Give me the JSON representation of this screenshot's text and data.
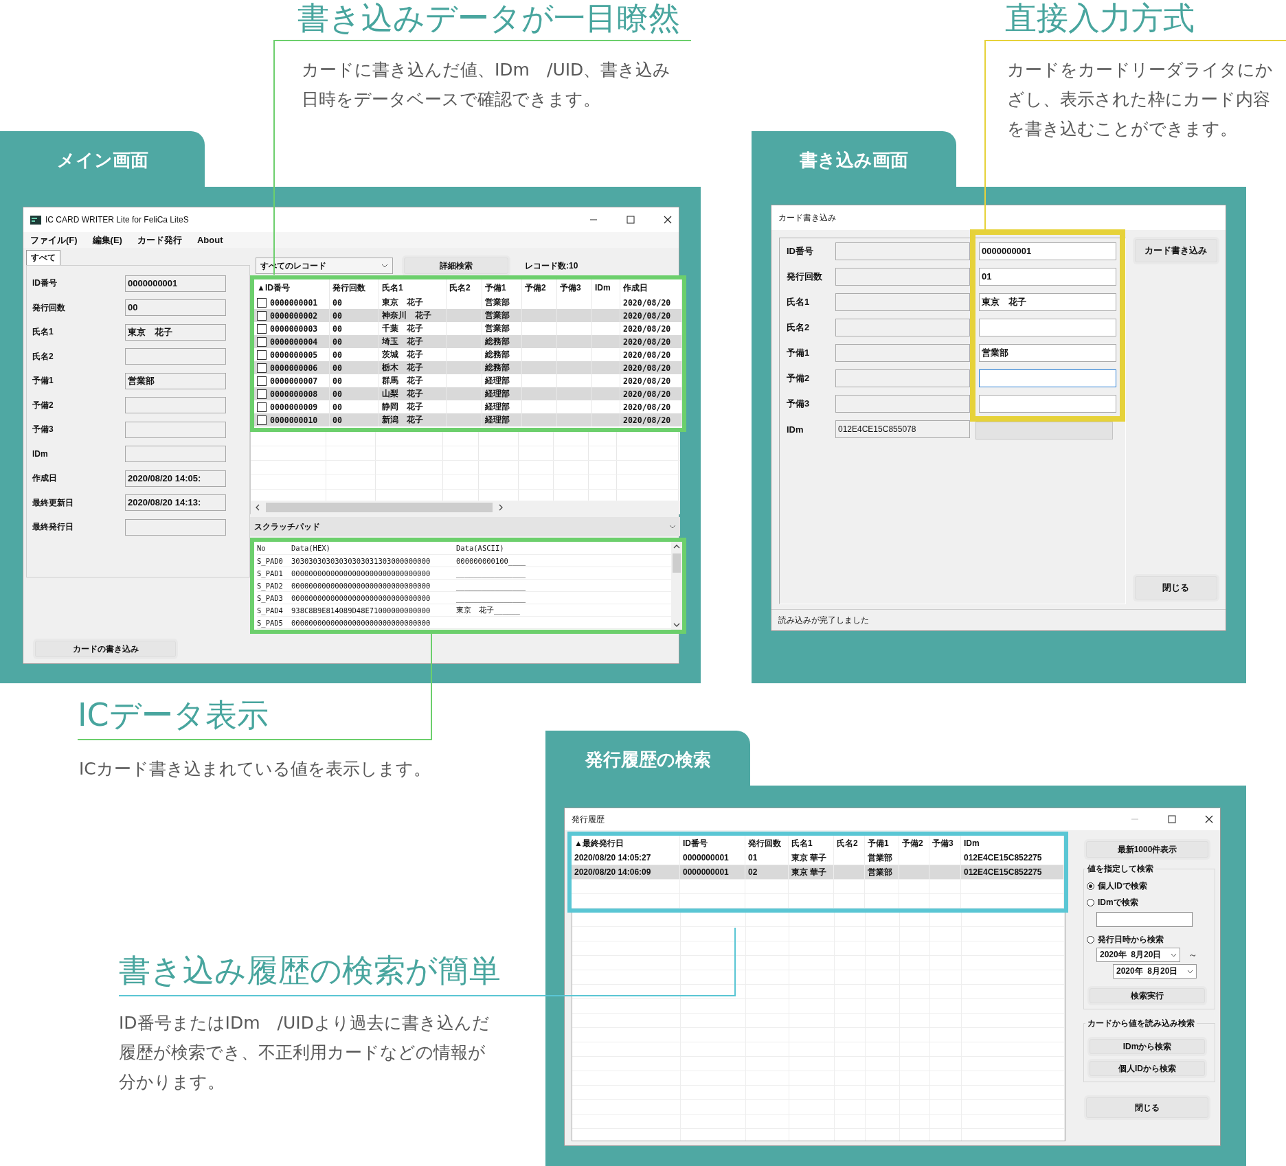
{
  "callouts": [
    {
      "title": "書き込みデータが一目瞭然",
      "lines": [
        "カードに書き込んだ値、IDm　/UID、書き込み",
        "日時をデータベースで確認できます。"
      ],
      "color": "#6ccf6c"
    },
    {
      "title": "直接入力方式",
      "lines": [
        "カードをカードリーダライタにか",
        "ざし、表示された枠にカード内容",
        "を書き込むことができます。"
      ],
      "color": "#e6d23a"
    },
    {
      "title": "ICデータ表示",
      "lines": [
        "ICカード書き込まれている値を表示します。"
      ],
      "color": "#6ccf6c"
    },
    {
      "title": "書き込み履歴の検索が簡単",
      "lines": [
        "ID番号またはIDm　/UIDより過去に書き込んだ",
        "履歴が検索でき、不正利用カードなどの情報が",
        "分かります。"
      ],
      "color": "#5ac6d4"
    }
  ],
  "panels": [
    "メイン画面",
    "書き込み画面",
    "発行履歴の検索"
  ],
  "main_window": {
    "title": "IC CARD WRITER Lite for FeliCa LiteS",
    "menu": [
      "ファイル(F)",
      "編集(E)",
      "カード発行",
      "About"
    ],
    "tabs": [
      {
        "label": "すべて",
        "selected": true
      }
    ],
    "fields": [
      {
        "label": "ID番号",
        "value": "0000000001"
      },
      {
        "label": "発行回数",
        "value": "00"
      },
      {
        "label": "氏名1",
        "value": "東京　花子"
      },
      {
        "label": "氏名2"
      },
      {
        "label": "予備1",
        "value": "営業部"
      },
      {
        "label": "予備2"
      },
      {
        "label": "予備3"
      },
      {
        "label": "IDm"
      },
      {
        "label": "作成日",
        "value": "2020/08/20 14:05:"
      },
      {
        "label": "最終更新日",
        "value": "2020/08/20 14:13:"
      },
      {
        "label": "最終発行日"
      }
    ],
    "write_button": "カードの書き込み",
    "record_filter": "すべてのレコード",
    "search_button": "詳細検索",
    "record_count": "レコード数:10",
    "columns": [
      "▲ID番号",
      "発行回数",
      "氏名1",
      "氏名2",
      "予備1",
      "予備2",
      "予備3",
      "IDm",
      "作成日"
    ],
    "rows": [
      {
        "checked": false,
        "id_number": "0000000001",
        "issue_count": "00",
        "name1": "東京　花子",
        "reserve1": "営業部",
        "created": "2020/08/20"
      },
      {
        "checked": false,
        "id_number": "0000000002",
        "issue_count": "00",
        "name1": "神奈川　花子",
        "reserve1": "営業部",
        "created": "2020/08/20"
      },
      {
        "checked": false,
        "id_number": "0000000003",
        "issue_count": "00",
        "name1": "千葉　花子",
        "reserve1": "営業部",
        "created": "2020/08/20"
      },
      {
        "checked": false,
        "id_number": "0000000004",
        "issue_count": "00",
        "name1": "埼玉　花子",
        "reserve1": "総務部",
        "created": "2020/08/20"
      },
      {
        "checked": false,
        "id_number": "0000000005",
        "issue_count": "00",
        "name1": "茨城　花子",
        "reserve1": "総務部",
        "created": "2020/08/20"
      },
      {
        "checked": false,
        "id_number": "0000000006",
        "issue_count": "00",
        "name1": "栃木　花子",
        "reserve1": "総務部",
        "created": "2020/08/20"
      },
      {
        "checked": false,
        "id_number": "0000000007",
        "issue_count": "00",
        "name1": "群馬　花子",
        "reserve1": "経理部",
        "created": "2020/08/20"
      },
      {
        "checked": false,
        "id_number": "0000000008",
        "issue_count": "00",
        "name1": "山梨　花子",
        "reserve1": "経理部",
        "created": "2020/08/20"
      },
      {
        "checked": false,
        "id_number": "0000000009",
        "issue_count": "00",
        "name1": "静岡　花子",
        "reserve1": "経理部",
        "created": "2020/08/20"
      },
      {
        "checked": false,
        "id_number": "0000000010",
        "issue_count": "00",
        "name1": "新潟　花子",
        "reserve1": "経理部",
        "created": "2020/08/20"
      }
    ],
    "scratchpad": {
      "title": "スクラッチパッド",
      "columns": [
        "No",
        "Data(HEX)",
        "Data(ASCII)"
      ],
      "rows": [
        {
          "no": "S_PAD0",
          "hex": "30303030303030303031303000000000",
          "ascii": "000000000100____"
        },
        {
          "no": "S_PAD1",
          "hex": "00000000000000000000000000000000",
          "ascii": "________________"
        },
        {
          "no": "S_PAD2",
          "hex": "00000000000000000000000000000000",
          "ascii": "________________"
        },
        {
          "no": "S_PAD3",
          "hex": "00000000000000000000000000000000",
          "ascii": "________________"
        },
        {
          "no": "S_PAD4",
          "hex": "938C8B9E814089D48E71000000000000",
          "ascii": "東京　花子______"
        },
        {
          "no": "S_PAD5",
          "hex": "00000000000000000000000000000000"
        }
      ]
    }
  },
  "write_window": {
    "title": "カード書き込み",
    "fields": [
      {
        "label": "ID番号",
        "input": "0000000001",
        "focused": false,
        "disabled": false
      },
      {
        "label": "発行回数",
        "input": "01",
        "focused": false,
        "disabled": false
      },
      {
        "label": "氏名1",
        "input": "東京　花子",
        "focused": false,
        "disabled": false
      },
      {
        "label": "氏名2",
        "focused": false,
        "disabled": false
      },
      {
        "label": "予備1",
        "input": "営業部",
        "focused": false,
        "disabled": false
      },
      {
        "label": "予備2",
        "focused": true,
        "disabled": false
      },
      {
        "label": "予備3",
        "focused": false,
        "disabled": false
      },
      {
        "label": "IDm",
        "current": "012E4CE15C855078",
        "focused": false,
        "disabled": true
      }
    ],
    "write_button": "カード書き込み",
    "close_button": "閉じる",
    "status": "読み込みが完了しました"
  },
  "history_window": {
    "title": "発行履歴",
    "columns": [
      "▲最終発行日",
      "ID番号",
      "発行回数",
      "氏名1",
      "氏名2",
      "予備1",
      "予備2",
      "予備3",
      "IDm"
    ],
    "rows": [
      {
        "last_issued": "2020/08/20 14:05:27",
        "id_number": "0000000001",
        "issue_count": "01",
        "name1": "東京 華子",
        "reserve1": "営業部",
        "idm": "012E4CE15C852275"
      },
      {
        "last_issued": "2020/08/20 14:06:09",
        "id_number": "0000000001",
        "issue_count": "02",
        "name1": "東京 華子",
        "reserve1": "営業部",
        "idm": "012E4CE15C852275"
      }
    ],
    "latest_button": "最新1000件表示",
    "value_search": {
      "title": "値を指定して検索",
      "options": [
        {
          "label": "個人IDで検索",
          "selected": true
        },
        {
          "label": "IDmで検索",
          "selected": false
        },
        {
          "label": "発行日時から検索",
          "selected": false
        }
      ],
      "date_from": "2020年  8月20日",
      "range_mark": "～",
      "date_to": "2020年  8月20日",
      "run_button": "検索実行"
    },
    "card_search": {
      "title": "カードから値を読み込み検索",
      "buttons": [
        "IDmから検索",
        "個人IDから検索"
      ]
    },
    "close_button": "閉じる"
  }
}
